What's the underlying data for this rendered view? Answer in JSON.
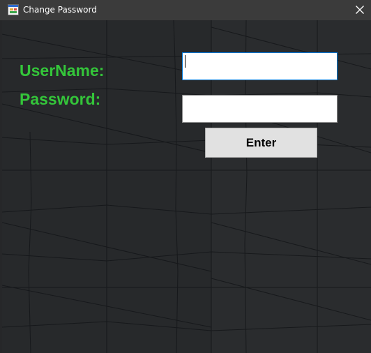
{
  "window": {
    "title": "Change Password"
  },
  "form": {
    "username_label": "UserName:",
    "password_label": "Password:",
    "username_value": "",
    "password_value": "",
    "enter_label": "Enter"
  },
  "colors": {
    "label_green": "#34c53a",
    "titlebar": "#3b3b3b",
    "background": "#27292b",
    "focus_border": "#0078d7"
  }
}
